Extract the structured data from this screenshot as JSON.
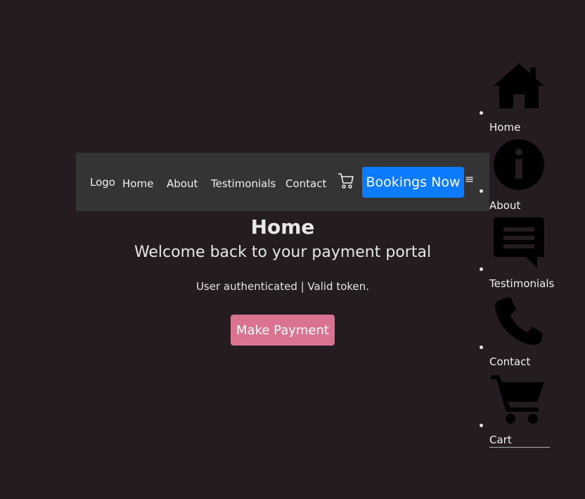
{
  "navbar": {
    "logo": "Logo",
    "links": [
      "Home",
      "About",
      "Testimonials",
      "Contact"
    ],
    "cart_icon": "cart-outline-icon",
    "booking_label": "Bookings Now",
    "menu_glyph": "≡",
    "booking_color": "#0d7bfd"
  },
  "main": {
    "title": "Home",
    "subtitle": "Welcome back to your payment portal",
    "status": "User authenticated | Valid token.",
    "pay_label": "Make Payment",
    "pay_color": "#d9738f"
  },
  "side_menu": {
    "items": [
      {
        "label": "Home",
        "icon": "home-icon"
      },
      {
        "label": "About",
        "icon": "info-icon"
      },
      {
        "label": "Testimonials",
        "icon": "message-icon"
      },
      {
        "label": "Contact",
        "icon": "phone-icon"
      },
      {
        "label": "Cart",
        "icon": "cart-icon"
      }
    ]
  },
  "colors": {
    "background": "#241c20",
    "navbar": "#343434"
  }
}
